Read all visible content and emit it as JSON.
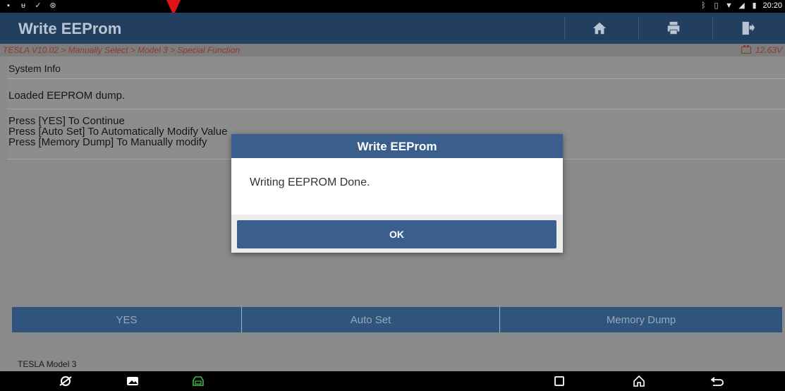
{
  "status_bar": {
    "time": "20:20",
    "left_icons": [
      "notification-square-icon",
      "usb-icon",
      "check-icon",
      "clock-icon"
    ],
    "right_icons": [
      "bluetooth-icon",
      "vibrate-icon",
      "wifi-icon",
      "signal-icon",
      "battery-icon"
    ]
  },
  "header": {
    "title": "Write EEProm",
    "buttons": [
      {
        "icon": "home-icon"
      },
      {
        "icon": "print-icon"
      },
      {
        "icon": "exit-icon"
      }
    ]
  },
  "breadcrumb": {
    "path": "TESLA V10.02 > Manually Select > Model 3 > Special Function",
    "voltage": "12.63V"
  },
  "content": {
    "section_title": "System Info",
    "status_message": "Loaded EEPROM dump.",
    "instructions": [
      "Press [YES] To Continue",
      "Press [Auto Set] To Automatically Modify Value",
      "Press [Memory Dump] To Manually modify"
    ]
  },
  "actions": {
    "yes_label": "YES",
    "auto_set_label": "Auto Set",
    "memory_dump_label": "Memory Dump"
  },
  "footer": {
    "model": "TESLA Model 3"
  },
  "dialog": {
    "title": "Write EEProm",
    "message": "Writing EEPROM Done.",
    "ok_label": "OK"
  },
  "colors": {
    "header_bg": "#223f60",
    "dialog_accent": "#3b5f8c",
    "breadcrumb_text": "#8e3a2e",
    "vci_icon": "#3dbb3d"
  },
  "navbar": {
    "icons": [
      "browser-icon",
      "gallery-icon",
      "vci-icon",
      "recent-apps-icon",
      "home-nav-icon",
      "back-icon"
    ]
  }
}
